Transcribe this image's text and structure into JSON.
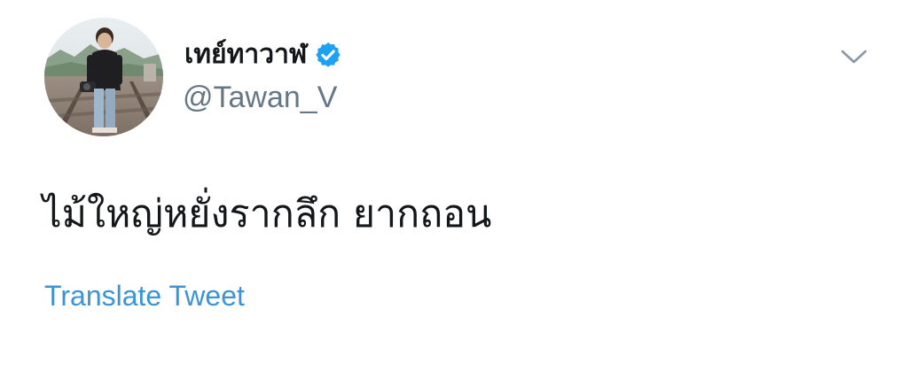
{
  "tweet": {
    "author": {
      "display_name": "เทย์ทาวาฬ",
      "handle": "@Tawan_V",
      "verified": true,
      "avatar_icon": "profile-photo"
    },
    "text": "ไม้ใหญ่หยั่งรากลึก ยากถอน",
    "translate_label": "Translate Tweet",
    "menu_icon": "chevron-down-icon"
  },
  "colors": {
    "name": "#14171a",
    "handle": "#657786",
    "link": "#3a94d6",
    "verified_badge": "#1da1f2",
    "caret": "#8899a6"
  }
}
